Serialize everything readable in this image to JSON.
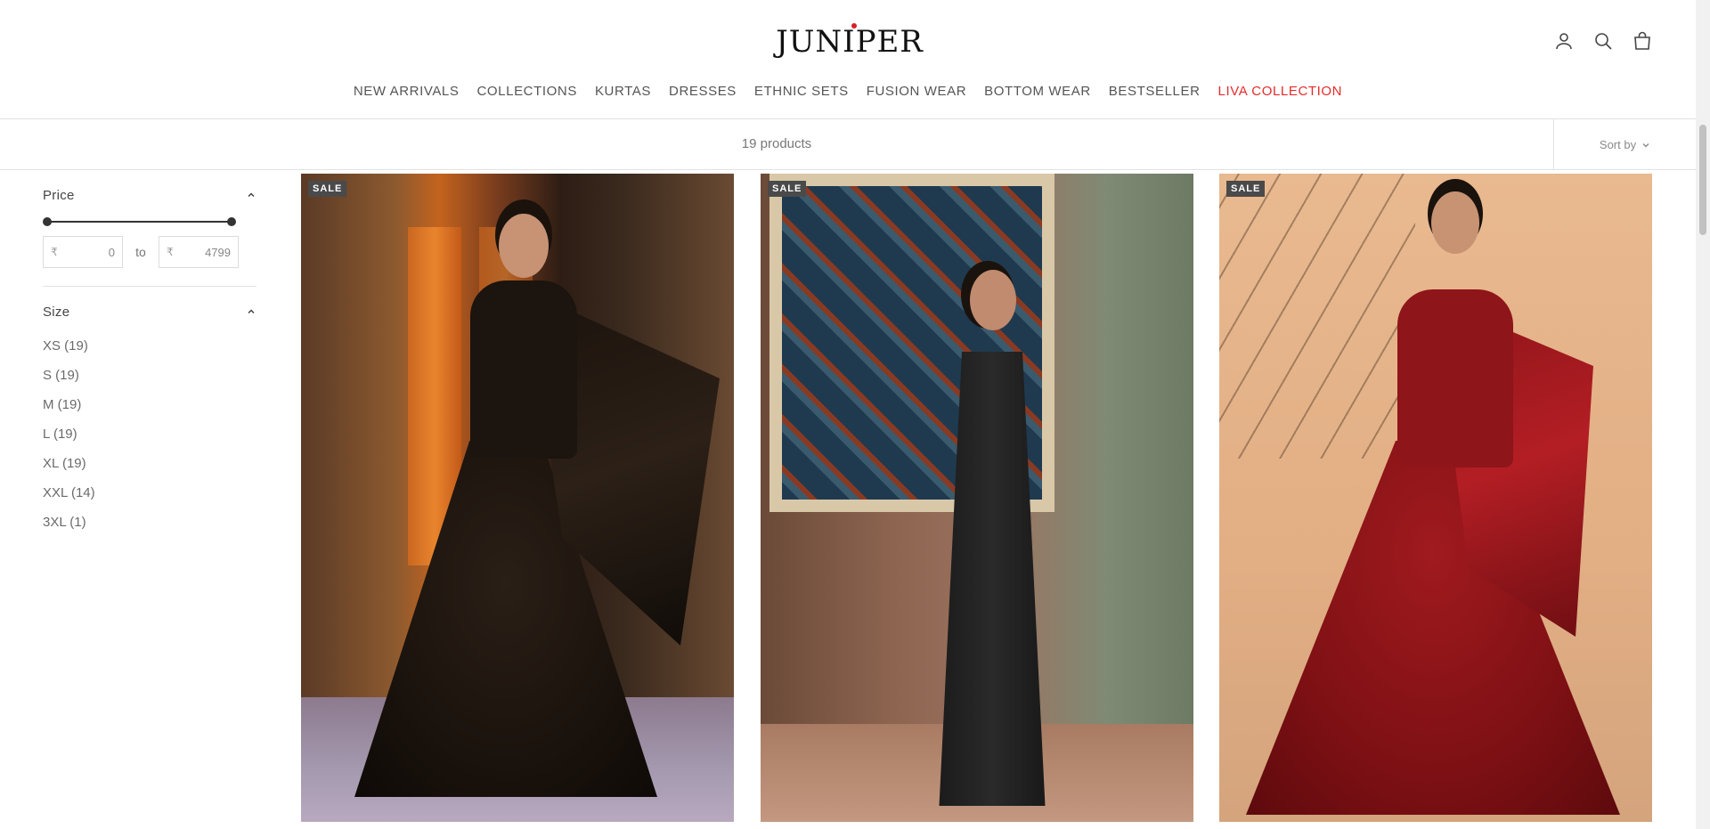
{
  "brand": {
    "logo_text": "JUNIPER"
  },
  "nav": {
    "items": [
      {
        "label": "NEW ARRIVALS"
      },
      {
        "label": "COLLECTIONS"
      },
      {
        "label": "KURTAS"
      },
      {
        "label": "DRESSES"
      },
      {
        "label": "ETHNIC SETS"
      },
      {
        "label": "FUSION WEAR"
      },
      {
        "label": "BOTTOM WEAR"
      },
      {
        "label": "BESTSELLER"
      },
      {
        "label": "LIVA COLLECTION",
        "highlight": true
      }
    ],
    "highlight_color": "#e42b2b"
  },
  "header_icons": [
    "account-icon",
    "search-icon",
    "cart-icon"
  ],
  "toolbar": {
    "product_count": "19 products",
    "sort_label": "Sort by"
  },
  "filters": {
    "price": {
      "title": "Price",
      "currency": "₹",
      "min": "0",
      "max": "4799",
      "to_label": "to"
    },
    "size": {
      "title": "Size",
      "options": [
        {
          "label": "XS (19)"
        },
        {
          "label": "S (19)"
        },
        {
          "label": "M (19)"
        },
        {
          "label": "L (19)"
        },
        {
          "label": "XL (19)"
        },
        {
          "label": "XXL (14)"
        },
        {
          "label": "3XL (1)"
        }
      ]
    }
  },
  "products": [
    {
      "badge": "SALE"
    },
    {
      "badge": "SALE"
    },
    {
      "badge": "SALE"
    }
  ]
}
